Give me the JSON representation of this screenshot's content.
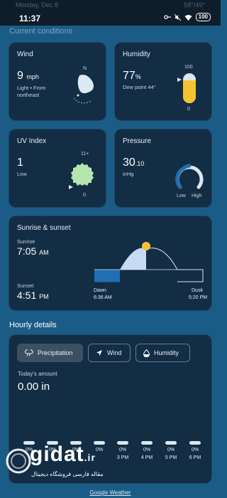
{
  "status_bar": {
    "time": "11:37",
    "ghost_left": "Monday, Dec 8",
    "ghost_right": "58°/49°",
    "battery": "100"
  },
  "section_label": "Current conditions",
  "wind": {
    "title": "Wind",
    "value": "9",
    "unit": "mph",
    "desc_line1": "Light • From",
    "desc_line2": "northeast",
    "compass_n": "N"
  },
  "humidity": {
    "title": "Humidity",
    "value": "77",
    "unit": "%",
    "dew_point": "Dew point 44°",
    "scale_max": "100",
    "scale_min": "0",
    "level": 0.77
  },
  "uv": {
    "title": "UV Index",
    "value": "1",
    "level_label": "Low",
    "scale_max": "11+",
    "scale_min": "0"
  },
  "pressure": {
    "title": "Pressure",
    "value": "30",
    "decimal": ".10",
    "unit": "inHg",
    "low": "Low",
    "high": "High"
  },
  "sun": {
    "title": "Sunrise & sunset",
    "sunrise_label": "Sunrise",
    "sunrise_time": "7:05",
    "sunrise_ampm": "AM",
    "sunset_label": "Sunset",
    "sunset_time": "4:51",
    "sunset_ampm": "PM",
    "dawn_label": "Dawn",
    "dawn_time": "6:36 AM",
    "dusk_label": "Dusk",
    "dusk_time": "5:20 PM"
  },
  "hourly": {
    "title": "Hourly details",
    "tabs": [
      "Precipitation",
      "Wind",
      "Humidity"
    ],
    "amount_label": "Today's amount",
    "amount_value": "0.00 in",
    "hours": [
      {
        "pct": "0%",
        "label": ""
      },
      {
        "pct": "0%",
        "label": ""
      },
      {
        "pct": "0%",
        "label": ""
      },
      {
        "pct": "0%",
        "label": ""
      },
      {
        "pct": "0%",
        "label": "3 PM"
      },
      {
        "pct": "0%",
        "label": "4 PM"
      },
      {
        "pct": "0%",
        "label": "5 PM"
      },
      {
        "pct": "0%",
        "label": "6 PM"
      }
    ]
  },
  "footer": {
    "link": "Google Weather"
  },
  "watermark": {
    "brand": "gidat",
    "suffix": ".ir",
    "tagline": "مقاله فارسی فروشگاه دیجیتال"
  },
  "colors": {
    "background": "#1b5c86",
    "card": "#132d45",
    "accent_yellow": "#f4c430",
    "accent_blue": "#1f6fb2",
    "uv_green": "#b6e5b0"
  }
}
